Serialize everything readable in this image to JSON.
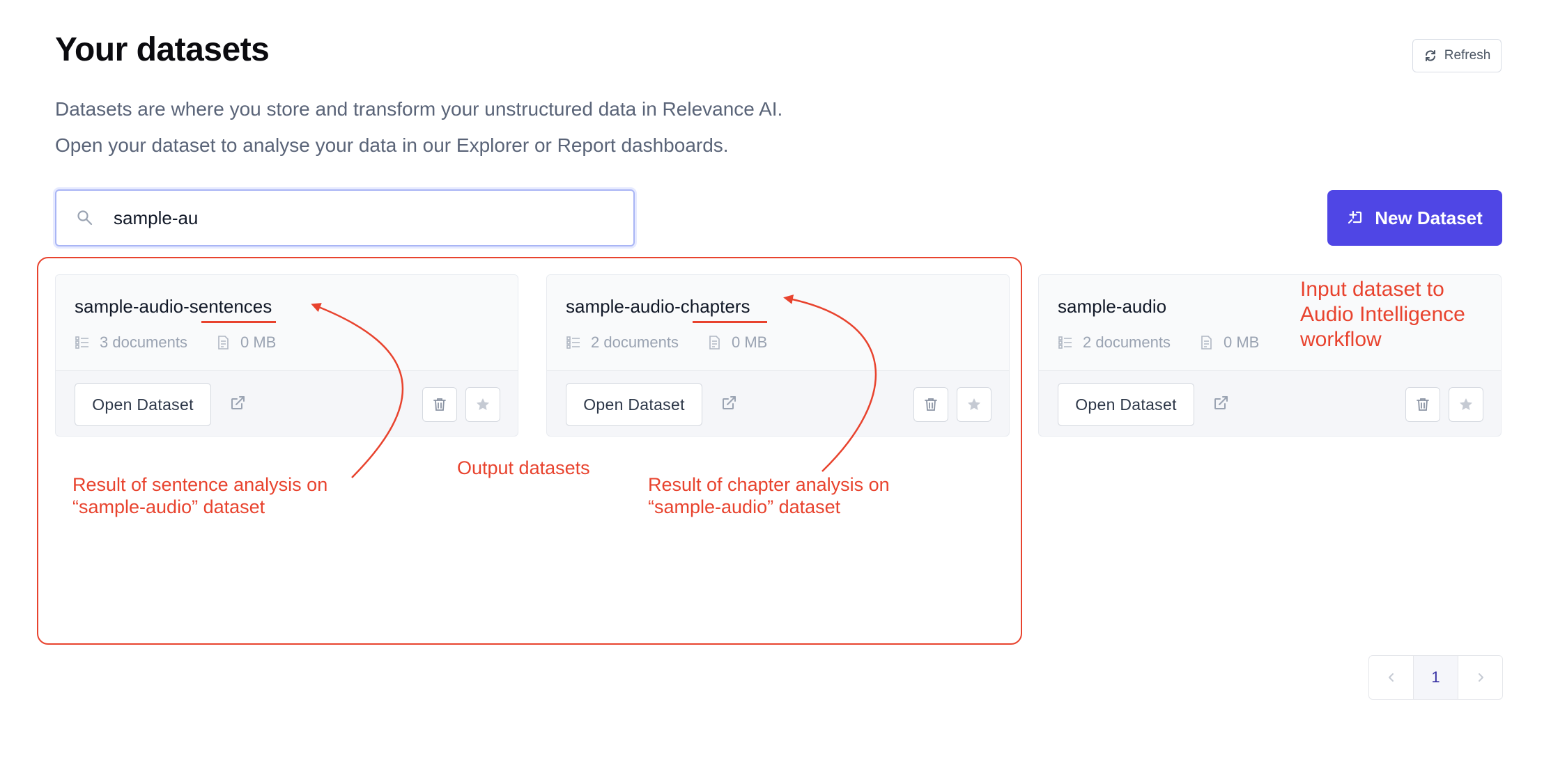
{
  "header": {
    "title": "Your datasets",
    "refresh_label": "Refresh",
    "description_line1": "Datasets are where you store and transform your unstructured data in Relevance AI.",
    "description_line2": "Open your dataset to analyse your data in our Explorer or Report dashboards."
  },
  "search": {
    "value": "sample-au"
  },
  "new_dataset_label": "New Dataset",
  "datasets": [
    {
      "name": "sample-audio-sentences",
      "documents": "3 documents",
      "size": "0 MB",
      "open_label": "Open Dataset"
    },
    {
      "name": "sample-audio-chapters",
      "documents": "2 documents",
      "size": "0 MB",
      "open_label": "Open Dataset"
    },
    {
      "name": "sample-audio",
      "documents": "2 documents",
      "size": "0 MB",
      "open_label": "Open Dataset"
    }
  ],
  "annotations": {
    "input_dataset": [
      "Input dataset to",
      "Audio Intelligence",
      "workflow"
    ],
    "output_datasets": "Output datasets",
    "sentence_result": [
      "Result of sentence analysis on",
      "“sample-audio” dataset"
    ],
    "chapter_result": [
      "Result of chapter analysis on",
      "“sample-audio” dataset"
    ]
  },
  "pagination": {
    "current_page": "1"
  },
  "colors": {
    "primary": "#4f46e5",
    "annotation": "#e8432e",
    "muted_text": "#5a6478"
  },
  "icons": [
    "refresh-icon",
    "search-icon",
    "new-dataset-icon",
    "documents-icon",
    "file-size-icon",
    "external-link-icon",
    "trash-icon",
    "star-icon",
    "chevron-left-icon",
    "chevron-right-icon"
  ]
}
